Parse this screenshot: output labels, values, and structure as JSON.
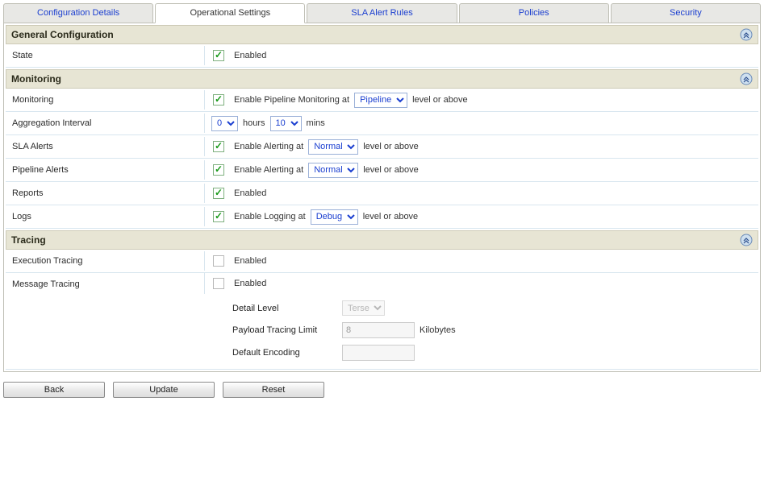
{
  "tabs": [
    {
      "label": "Configuration Details",
      "active": false
    },
    {
      "label": "Operational Settings",
      "active": true
    },
    {
      "label": "SLA Alert Rules",
      "active": false
    },
    {
      "label": "Policies",
      "active": false
    },
    {
      "label": "Security",
      "active": false
    }
  ],
  "sections": {
    "general": {
      "title": "General Configuration"
    },
    "monitoring": {
      "title": "Monitoring"
    },
    "tracing": {
      "title": "Tracing"
    }
  },
  "rows": {
    "state": {
      "label": "State",
      "enabled_text": "Enabled",
      "checked": true
    },
    "monitoring": {
      "label": "Monitoring",
      "checked": true,
      "prefix": "Enable Pipeline Monitoring at",
      "select": "Pipeline",
      "suffix": "level or above"
    },
    "agg": {
      "label": "Aggregation Interval",
      "hours_val": "0",
      "hours_text": "hours",
      "mins_val": "10",
      "mins_text": "mins"
    },
    "sla": {
      "label": "SLA Alerts",
      "checked": true,
      "prefix": "Enable Alerting at",
      "select": "Normal",
      "suffix": "level or above"
    },
    "pipeline_alerts": {
      "label": "Pipeline Alerts",
      "checked": true,
      "prefix": "Enable Alerting at",
      "select": "Normal",
      "suffix": "level or above"
    },
    "reports": {
      "label": "Reports",
      "checked": true,
      "enabled_text": "Enabled"
    },
    "logs": {
      "label": "Logs",
      "checked": true,
      "prefix": "Enable Logging at",
      "select": "Debug",
      "suffix": "level or above"
    },
    "exec_tracing": {
      "label": "Execution Tracing",
      "checked": false,
      "enabled_text": "Enabled"
    },
    "msg_tracing": {
      "label": "Message Tracing",
      "checked": false,
      "enabled_text": "Enabled",
      "detail_level_label": "Detail Level",
      "detail_level_value": "Terse",
      "payload_label": "Payload Tracing Limit",
      "payload_value": "8",
      "payload_unit": "Kilobytes",
      "encoding_label": "Default Encoding",
      "encoding_value": ""
    }
  },
  "buttons": {
    "back": "Back",
    "update": "Update",
    "reset": "Reset"
  }
}
